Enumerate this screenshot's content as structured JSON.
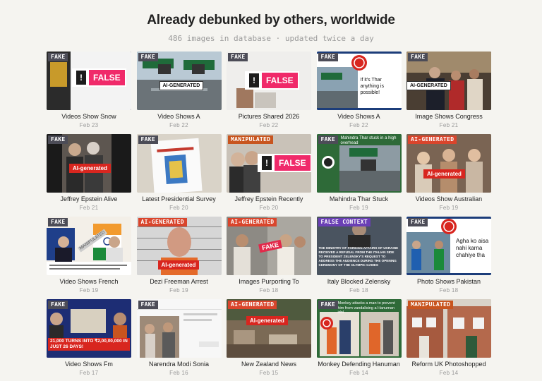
{
  "page": {
    "title": "Already debunked by others, worldwide",
    "subtitle": "486 images in database · updated twice a day"
  },
  "cards": [
    {
      "badge": "FAKE",
      "caption": "Videos Show Snow",
      "date": "Feb 23",
      "overlay": "FALSE",
      "overlay_mark": "!"
    },
    {
      "badge": "FAKE",
      "caption": "Video Shows A",
      "date": "Feb 22",
      "overlay": "AI-GENERATED"
    },
    {
      "badge": "FAKE",
      "caption": "Pictures Shared 2026",
      "date": "Feb 22",
      "overlay": "FALSE",
      "overlay_mark": "!"
    },
    {
      "badge": "FAKE",
      "caption": "Video Shows A",
      "date": "Feb 22",
      "overlay": "If it's Thar anything is possible!"
    },
    {
      "badge": "FAKE",
      "caption": "Image Shows Congress",
      "date": "Feb 21",
      "overlay": "AI-GENERATED"
    },
    {
      "badge": "FAKE",
      "caption": "Jeffrey Epstein Alive",
      "date": "Feb 21",
      "overlay": "AI-generated"
    },
    {
      "badge": "FAKE",
      "caption": "Latest Presidential Survey",
      "date": "Feb 20",
      "overlay": ""
    },
    {
      "badge": "MANIPULATED",
      "caption": "Jeffrey Epstein Recently",
      "date": "Feb 20",
      "overlay": "FALSE",
      "overlay_mark": "!"
    },
    {
      "badge": "FAKE",
      "caption": "Mahindra Thar Stuck",
      "date": "Feb 19",
      "overlay": "Mahindra Thar stuck in a high overhead"
    },
    {
      "badge": "AI-GENERATED",
      "caption": "Videos Show Australian",
      "date": "Feb 19",
      "overlay": "AI-generated"
    },
    {
      "badge": "FAKE",
      "caption": "Video Shows French",
      "date": "Feb 19",
      "overlay": "MANIPULATED"
    },
    {
      "badge": "AI-GENERATED",
      "caption": "Dezi Freeman Arrest",
      "date": "Feb 19",
      "overlay": "AI-generated"
    },
    {
      "badge": "AI-GENERATED",
      "caption": "Images Purporting To",
      "date": "Feb 18",
      "overlay": "FAKE"
    },
    {
      "badge": "FALSE CONTEXT",
      "caption": "Italy Blocked Zelensky",
      "date": "Feb 18",
      "overlay": "THE MINISTRY OF FOREIGN AFFAIRS OF UKRAINE RECEIVED A REFUSAL FROM THE ITALIAN SIDE TO PRESIDENT ZELENSKY'S REQUEST TO ADDRESS THE AUDIENCE DURING THE OPENING CEREMONY OF THE OLYMPIC GAMES"
    },
    {
      "badge": "FAKE",
      "caption": "Photo Shows Pakistan",
      "date": "Feb 18",
      "overlay": "Agha ko aisa nahi karna chahiye tha"
    },
    {
      "badge": "FAKE",
      "caption": "Video Shows Fm",
      "date": "Feb 17",
      "overlay": "21,000 TURNS INTO ₹2,00,00,000 IN JUST 26 DAYS!"
    },
    {
      "badge": "FAKE",
      "caption": "Narendra Modi Sonia",
      "date": "Feb 16",
      "overlay": ""
    },
    {
      "badge": "AI-GENERATED",
      "caption": "New Zealand News",
      "date": "Feb 15",
      "overlay": "AI-generated"
    },
    {
      "badge": "FAKE",
      "caption": "Monkey Defending Hanuman",
      "date": "Feb 14",
      "overlay": "Monkey attacks a man to prevent him from vandalising a Hanuman idol"
    },
    {
      "badge": "MANIPULATED",
      "caption": "Reform UK Photoshopped",
      "date": "Feb 14",
      "overlay": ""
    }
  ]
}
